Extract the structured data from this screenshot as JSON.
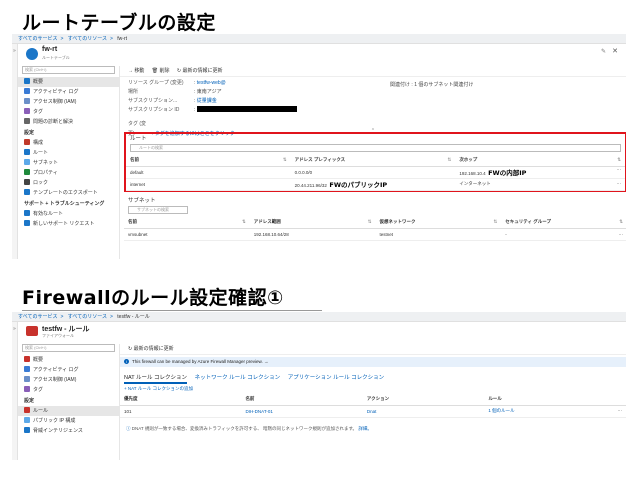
{
  "headings": {
    "title1": "ルートテーブルの設定",
    "title2": "Firewallのルール設定確認①"
  },
  "panel1": {
    "breadcrumb": [
      "すべてのサービス",
      "すべてのリソース",
      "fw-rt"
    ],
    "resource_name": "fw-rt",
    "resource_type": "ルートテーブル",
    "search_placeholder": "検索 (Ctrl+/)",
    "nav": [
      {
        "label": "概要",
        "selected": true
      },
      {
        "label": "アクティビティ ログ"
      },
      {
        "label": "アクセス制御 (IAM)"
      },
      {
        "label": "タグ"
      },
      {
        "label": "問題の診断と解決"
      }
    ],
    "section_settings": "設定",
    "nav_settings": [
      {
        "label": "構成"
      },
      {
        "label": "ルート"
      },
      {
        "label": "サブネット"
      },
      {
        "label": "プロパティ"
      },
      {
        "label": "ロック"
      },
      {
        "label": "テンプレートのエクスポート"
      }
    ],
    "section_support": "サポート + トラブルシューティング",
    "nav_support": [
      {
        "label": "有効なルート"
      },
      {
        "label": "新しいサポート リクエスト"
      }
    ],
    "toolbar": [
      "→ 移動",
      "🗑 削除",
      "↻ 最新の情報に更新"
    ],
    "essentials": [
      {
        "key": "リソース グループ (変更)",
        "value": "testfw-web@"
      },
      {
        "key": "場所",
        "value": "東南アジア"
      },
      {
        "key": "サブスクリプション...",
        "value": "従量課金"
      },
      {
        "key": "サブスクリプション ID",
        "value": ""
      }
    ],
    "related_key": "関連付け",
    "related_value": "1 個のサブネット関連付け",
    "tags_key": "タグ (変更)",
    "tags_link": "タグを追加するにはここをクリック",
    "routes_title": "ルート",
    "routes_search": "ルートの検索",
    "routes_headers": [
      "名前",
      "アドレス プレフィックス",
      "次ホップ"
    ],
    "routes_rows": [
      {
        "name": "default",
        "prefix": "0.0.0.0/0",
        "hop": "192.168.10.4"
      },
      {
        "name": "internet",
        "prefix": "20.44.211.96/32",
        "hop": "インターネット"
      }
    ],
    "annotation_hop": "FWの内部IP",
    "annotation_prefix": "FWのパブリックIP",
    "subnets_title": "サブネット",
    "subnets_search": "サブネットの検索",
    "subnets_headers": [
      "名前",
      "アドレス範囲",
      "仮想ネットワーク",
      "セキュリティ グループ"
    ],
    "subnets_rows": [
      {
        "name": "vmsubnet",
        "range": "192.168.10.64/28",
        "vnet": "testnet",
        "nsg": "-"
      }
    ],
    "more": "···"
  },
  "panel2": {
    "breadcrumb": [
      "すべてのサービス",
      "すべてのリソース",
      "testfw - ルール"
    ],
    "resource_name": "testfw - ルール",
    "resource_type": "ファイアウォール",
    "search_placeholder": "検索 (Ctrl+/)",
    "nav": [
      {
        "label": "概要"
      },
      {
        "label": "アクティビティ ログ"
      },
      {
        "label": "アクセス制御 (IAM)"
      },
      {
        "label": "タグ"
      }
    ],
    "section_settings": "設定",
    "nav_settings": [
      {
        "label": "ルール",
        "selected": true
      },
      {
        "label": "パブリック IP 構成"
      },
      {
        "label": "脅威インテリジェンス"
      }
    ],
    "toolbar": [
      "↻ 最新の情報に更新"
    ],
    "banner": "This firewall can be managed by Azure Firewall Manager preview. →",
    "tabs": [
      "NAT ルール コレクション",
      "ネットワーク ルール コレクション",
      "アプリケーション ルール コレクション"
    ],
    "add_link": "+ NAT ルール コレクションの追加",
    "headers": [
      "優先度",
      "名前",
      "アクション",
      "ルール"
    ],
    "rows": [
      {
        "priority": "101",
        "name": "DIH-DNAT-01",
        "action": "Dnat",
        "rule": "1 個のルール"
      }
    ],
    "footer_text": "DNAT 規則が一致する場合、変換済みトラフィックを許可する、 暗黙の同じネットワーク規則が追加されます。",
    "footer_link": "詳細。",
    "more": "···"
  }
}
